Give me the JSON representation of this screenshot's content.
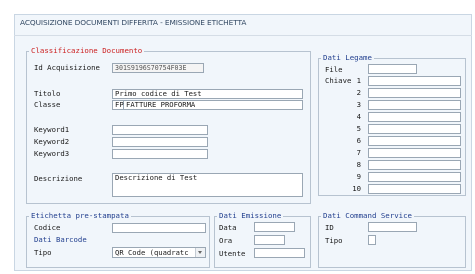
{
  "window": {
    "title": "ACQUISIZIONE DOCUMENTI DIFFERITA - EMISSIONE ETICHETTA"
  },
  "classificazione": {
    "legend": "Classificazione Documento",
    "id_label": "Id Acquisizione",
    "id_value": "301S9196S70754F03E",
    "titolo_label": "Titolo",
    "titolo_value": "Primo codice di Test",
    "classe_label": "Classe",
    "classe_code": "FP",
    "classe_value": "FATTURE PROFORMA",
    "keyword1_label": "Keyword1",
    "keyword2_label": "Keyword2",
    "keyword3_label": "Keyword3",
    "keyword1_value": "",
    "keyword2_value": "",
    "keyword3_value": "",
    "descrizione_label": "Descrizione",
    "descrizione_value": "Descrizione di Test"
  },
  "legame": {
    "legend": "Dati Legame",
    "file_label": "File",
    "chiave_label": "Chiave",
    "chiavi": [
      "1",
      "2",
      "3",
      "4",
      "5",
      "6",
      "7",
      "8",
      "9",
      "10"
    ]
  },
  "etichetta": {
    "legend": "Etichetta pre-stampata",
    "codice_label": "Codice",
    "codice_value": ""
  },
  "barcode": {
    "legend": "Dati Barcode",
    "tipo_label": "Tipo",
    "tipo_value": "QR Code (quadratc"
  },
  "emissione": {
    "legend": "Dati Emissione",
    "data_label": "Data",
    "ora_label": "Ora",
    "utente_label": "Utente"
  },
  "command": {
    "legend": "Dati Command Service",
    "id_label": "ID",
    "tipo_label": "Tipo"
  },
  "colors": {
    "legend_red": "#cc1f1f",
    "legend_blue": "#23408f",
    "panel_bg": "#f1f6fb"
  }
}
